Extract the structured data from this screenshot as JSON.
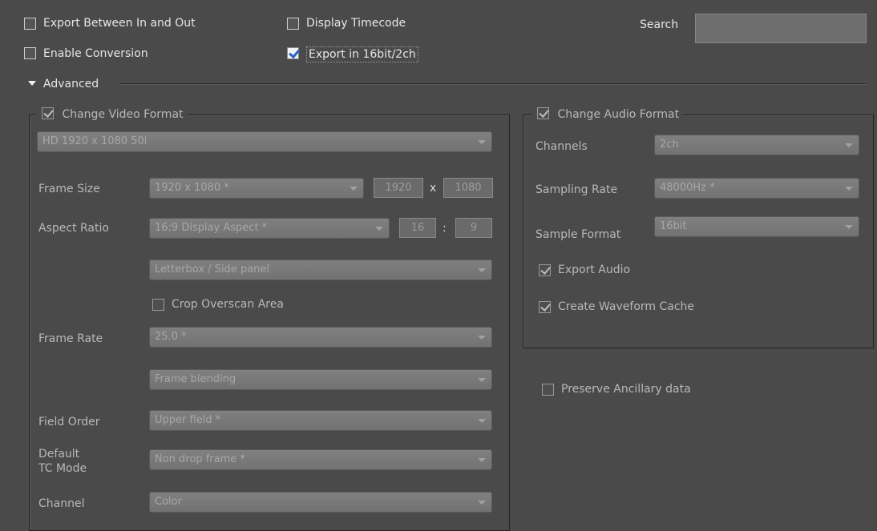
{
  "top": {
    "export_between": {
      "label": "Export Between In and Out",
      "checked": false
    },
    "display_timecode": {
      "label": "Display Timecode",
      "checked": false
    },
    "enable_conversion": {
      "label": "Enable Conversion",
      "checked": false
    },
    "export_16bit": {
      "label": "Export in 16bit/2ch",
      "checked": true
    },
    "search_label": "Search",
    "search_value": ""
  },
  "advanced": {
    "label": "Advanced",
    "expanded": true
  },
  "video": {
    "group_label": "Change Video Format",
    "checked": true,
    "preset": "HD 1920 x 1080 50i",
    "frame_size": {
      "label": "Frame Size",
      "value": "1920 x 1080 *",
      "width": "1920",
      "sep": "x",
      "height": "1080"
    },
    "aspect_ratio": {
      "label": "Aspect Ratio",
      "value": "16:9 Display Aspect *",
      "w": "16",
      "sep": ":",
      "h": "9"
    },
    "letterbox": "Letterbox / Side panel",
    "crop_overscan": {
      "label": "Crop Overscan Area",
      "checked": false
    },
    "frame_rate": {
      "label": "Frame Rate",
      "value": "25.0 *"
    },
    "frame_blending": "Frame blending",
    "field_order": {
      "label": "Field Order",
      "value": "Upper field *"
    },
    "default_tc": {
      "label_line1": "Default",
      "label_line2": "TC Mode",
      "value": "Non drop frame *"
    },
    "channel": {
      "label": "Channel",
      "value": "Color"
    }
  },
  "audio": {
    "group_label": "Change Audio Format",
    "checked": true,
    "channels": {
      "label": "Channels",
      "value": "2ch"
    },
    "sampling_rate": {
      "label": "Sampling Rate",
      "value": "48000Hz *"
    },
    "sample_format": {
      "label": "Sample Format",
      "value": "16bit"
    },
    "export_audio": {
      "label": "Export Audio",
      "checked": true
    },
    "waveform_cache": {
      "label": "Create Waveform Cache",
      "checked": true
    }
  },
  "preserve_ancillary": {
    "label": "Preserve Ancillary data",
    "checked": false
  },
  "colors": {
    "background": "#4a4a4a",
    "check_accent": "#2a63c8",
    "dropdown": "#7a7a7a"
  }
}
